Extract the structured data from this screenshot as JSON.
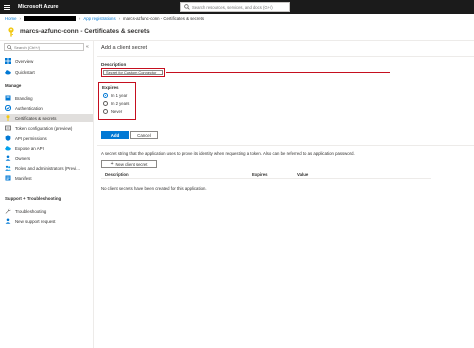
{
  "topbar": {
    "brand": "Microsoft Azure",
    "search_placeholder": "Search resources, services, and docs (G+/)"
  },
  "breadcrumb": {
    "home": "Home",
    "app_registrations": "App registrations",
    "current": "marcs-azfunc-conn - Certificates & secrets"
  },
  "page": {
    "title": "marcs-azfunc-conn - Certificates & secrets"
  },
  "sidebar": {
    "search_placeholder": "Search (Ctrl+/)",
    "collapse": "«",
    "items_top": [
      {
        "label": "Overview",
        "icon": "grid-icon"
      },
      {
        "label": "Quickstart",
        "icon": "cloud-icon"
      }
    ],
    "manage_heading": "Manage",
    "manage_items": [
      {
        "label": "Branding",
        "icon": "branding-icon"
      },
      {
        "label": "Authentication",
        "icon": "authentication-icon"
      },
      {
        "label": "Certificates & secrets",
        "icon": "key-icon"
      },
      {
        "label": "Token configuration (preview)",
        "icon": "token-icon"
      },
      {
        "label": "API permissions",
        "icon": "permissions-icon"
      },
      {
        "label": "Expose an API",
        "icon": "cloud-api-icon"
      },
      {
        "label": "Owners",
        "icon": "owners-icon"
      },
      {
        "label": "Roles and administrators (Previ...",
        "icon": "roles-icon"
      },
      {
        "label": "Manifest",
        "icon": "manifest-icon"
      }
    ],
    "support_heading": "Support + Troubleshooting",
    "support_items": [
      {
        "label": "Troubleshooting",
        "icon": "wrench-icon"
      },
      {
        "label": "New support request",
        "icon": "person-icon"
      }
    ]
  },
  "panel": {
    "title": "Add a client secret",
    "description_label": "Description",
    "description_value": "Secret for Custom Connector",
    "expires_label": "Expires",
    "expires_options": [
      "In 1 year",
      "In 2 years",
      "Never"
    ],
    "expires_selected": "In 1 year",
    "add_label": "Add",
    "cancel_label": "Cancel"
  },
  "secrets": {
    "info": "A secret string that the application uses to prove its identity when requesting a token. Also can be referred to as application password.",
    "new_button": "New client secret",
    "columns": [
      "Description",
      "Expires",
      "Value"
    ],
    "empty_text": "No client secrets have been created for this application."
  },
  "colors": {
    "accent": "#0078d4",
    "topbar": "#1b1b1b",
    "highlight": "#c50f1f",
    "active_item": "#e1dfdd"
  }
}
